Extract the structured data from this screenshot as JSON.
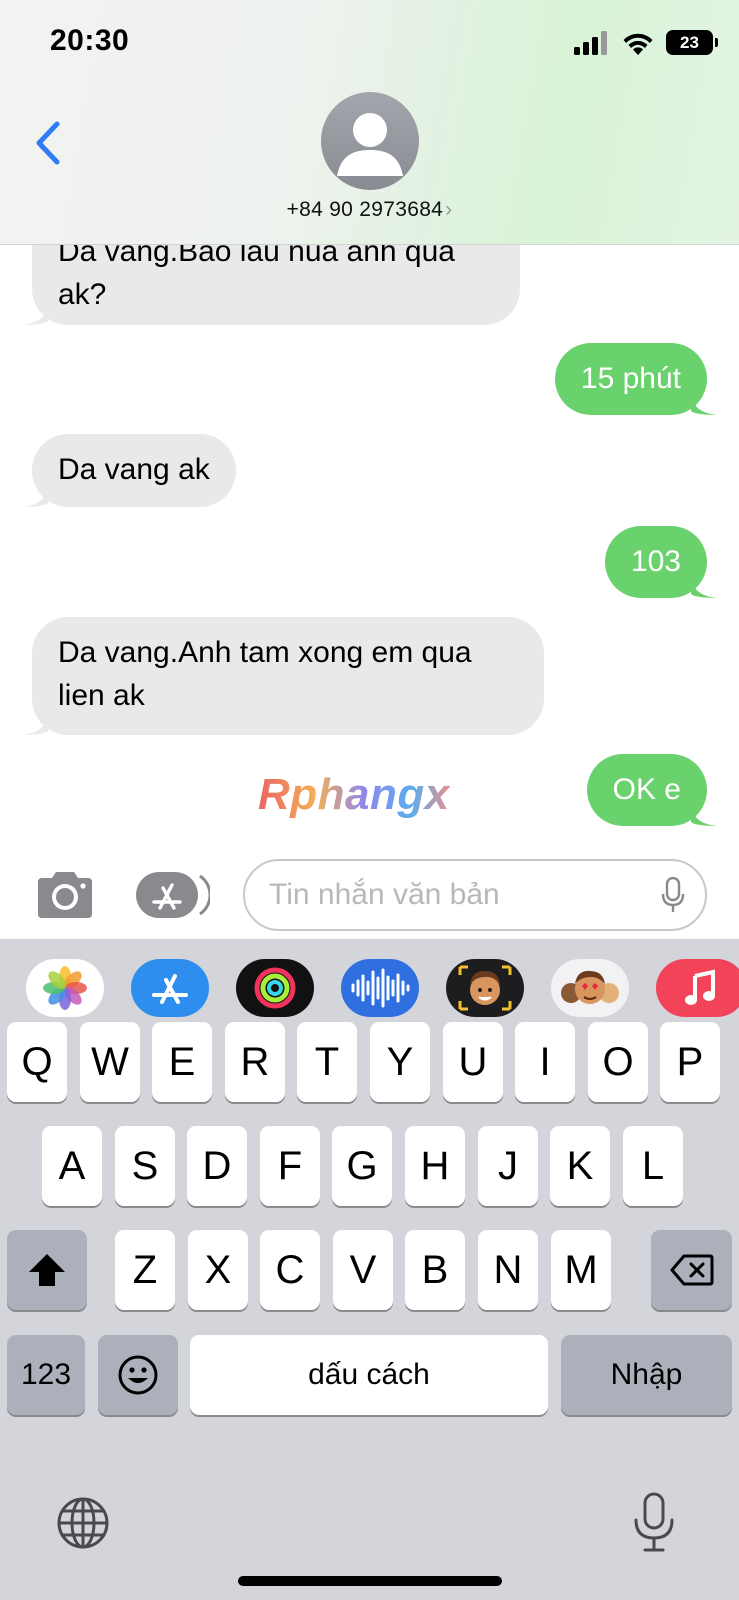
{
  "status": {
    "time": "20:30",
    "battery": "23"
  },
  "header": {
    "contact": "+84 90 2973684",
    "chevron": "›"
  },
  "messages": [
    {
      "dir": "in",
      "text": "Da vang.Bao lau nua anh qua ak?"
    },
    {
      "dir": "out",
      "text": "15 phút"
    },
    {
      "dir": "in",
      "text": "Da vang ak"
    },
    {
      "dir": "out",
      "text": "103"
    },
    {
      "dir": "in",
      "text": "Da vang.Anh tam xong em qua lien ak"
    },
    {
      "dir": "out",
      "text": "OK e"
    }
  ],
  "watermark": "Rphangx",
  "input": {
    "placeholder": "Tin nhắn văn bản",
    "value": ""
  },
  "app_strip": [
    "photos-icon",
    "app-store-icon",
    "activity-icon",
    "audio-message-icon",
    "memoji-icon",
    "memoji-stickers-icon",
    "music-icon"
  ],
  "keyboard": {
    "row1": [
      "Q",
      "W",
      "E",
      "R",
      "T",
      "Y",
      "U",
      "I",
      "O",
      "P"
    ],
    "row2": [
      "A",
      "S",
      "D",
      "F",
      "G",
      "H",
      "J",
      "K",
      "L"
    ],
    "row3": [
      "Z",
      "X",
      "C",
      "V",
      "B",
      "N",
      "M"
    ],
    "numbers_key": "123",
    "space_key": "dấu cách",
    "return_key": "Nhập"
  },
  "colors": {
    "incoming": "#e9e9eb",
    "outgoing": "#6ad26c",
    "accent": "#2f7cf6"
  }
}
